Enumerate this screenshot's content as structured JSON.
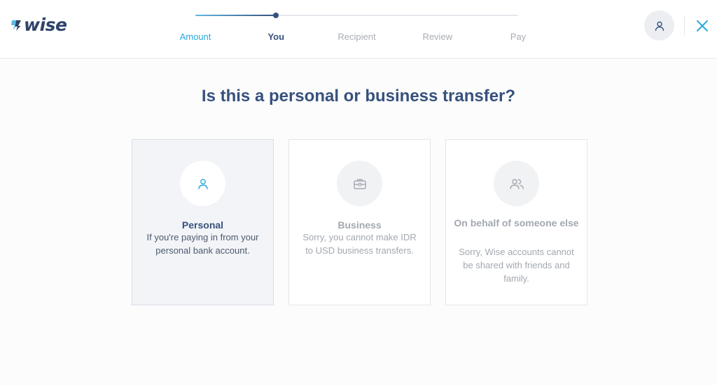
{
  "brand": {
    "name": "wise",
    "color": "#2e4369",
    "accent": "#29a8e0"
  },
  "stepper": {
    "steps": [
      {
        "label": "Amount",
        "state": "done"
      },
      {
        "label": "You",
        "state": "active"
      },
      {
        "label": "Recipient",
        "state": "upcoming"
      },
      {
        "label": "Review",
        "state": "upcoming"
      },
      {
        "label": "Pay",
        "state": "upcoming"
      }
    ],
    "progress": 0.25
  },
  "header": {
    "account_icon": "user-icon",
    "close_icon": "close-icon"
  },
  "main": {
    "title": "Is this a personal or business transfer?",
    "options": [
      {
        "icon": "user-icon",
        "title": "Personal",
        "description": "If you're paying in from your personal bank account.",
        "selected": true
      },
      {
        "icon": "briefcase-icon",
        "title": "Business",
        "description": "Sorry, you cannot make IDR to USD business transfers.",
        "selected": false
      },
      {
        "icon": "users-icon",
        "title": "On behalf of someone else",
        "description": "Sorry, Wise accounts cannot be shared with friends and family.",
        "selected": false
      }
    ]
  }
}
